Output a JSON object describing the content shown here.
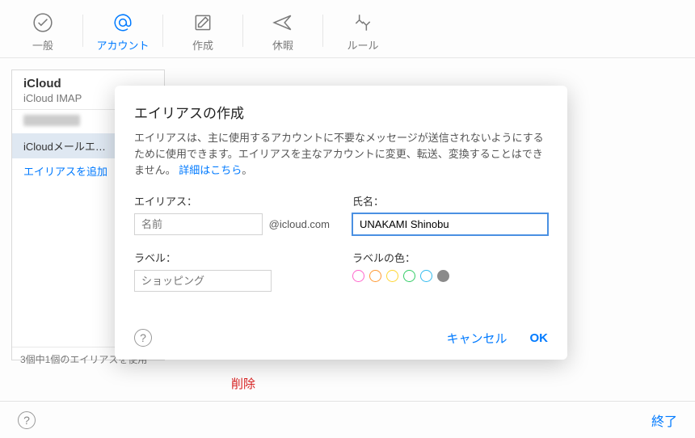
{
  "toolbar": {
    "items": [
      {
        "key": "general",
        "label": "一般"
      },
      {
        "key": "accounts",
        "label": "アカウント"
      },
      {
        "key": "compose",
        "label": "作成"
      },
      {
        "key": "vacation",
        "label": "休暇"
      },
      {
        "key": "rules",
        "label": "ルール"
      }
    ],
    "active_index": 1
  },
  "sidebar": {
    "account_title": "iCloud",
    "account_sub": "iCloud IMAP",
    "rows": [
      {
        "label": "",
        "blurred": true
      },
      {
        "label": "iCloudメールエ…",
        "selected": true
      },
      {
        "label": "エイリアスを追加",
        "link": true
      }
    ],
    "footer": "3個中1個のエイリアスを使用"
  },
  "content": {
    "delete_label": "削除"
  },
  "modal": {
    "title": "エイリアスの作成",
    "description": "エイリアスは、主に使用するアカウントに不要なメッセージが送信されないようにするために使用できます。エイリアスを主なアカウントに変更、転送、変換することはできません。",
    "more_link": "詳細はこちら",
    "more_suffix": "。",
    "alias_label": "エイリアス：",
    "alias_placeholder": "名前",
    "alias_value": "",
    "alias_suffix": "@icloud.com",
    "fullname_label": "氏名：",
    "fullname_value": "UNAKAMI Shinobu",
    "label_label": "ラベル：",
    "label_placeholder": "ショッピング",
    "label_value": "",
    "color_label": "ラベルの色：",
    "colors": [
      "#ff66cc",
      "#ff9933",
      "#ffd633",
      "#33cc66",
      "#33bbee",
      "#8a8a8a"
    ],
    "selected_color_index": 5,
    "cancel": "キャンセル",
    "ok": "OK"
  },
  "bottombar": {
    "done": "終了"
  }
}
